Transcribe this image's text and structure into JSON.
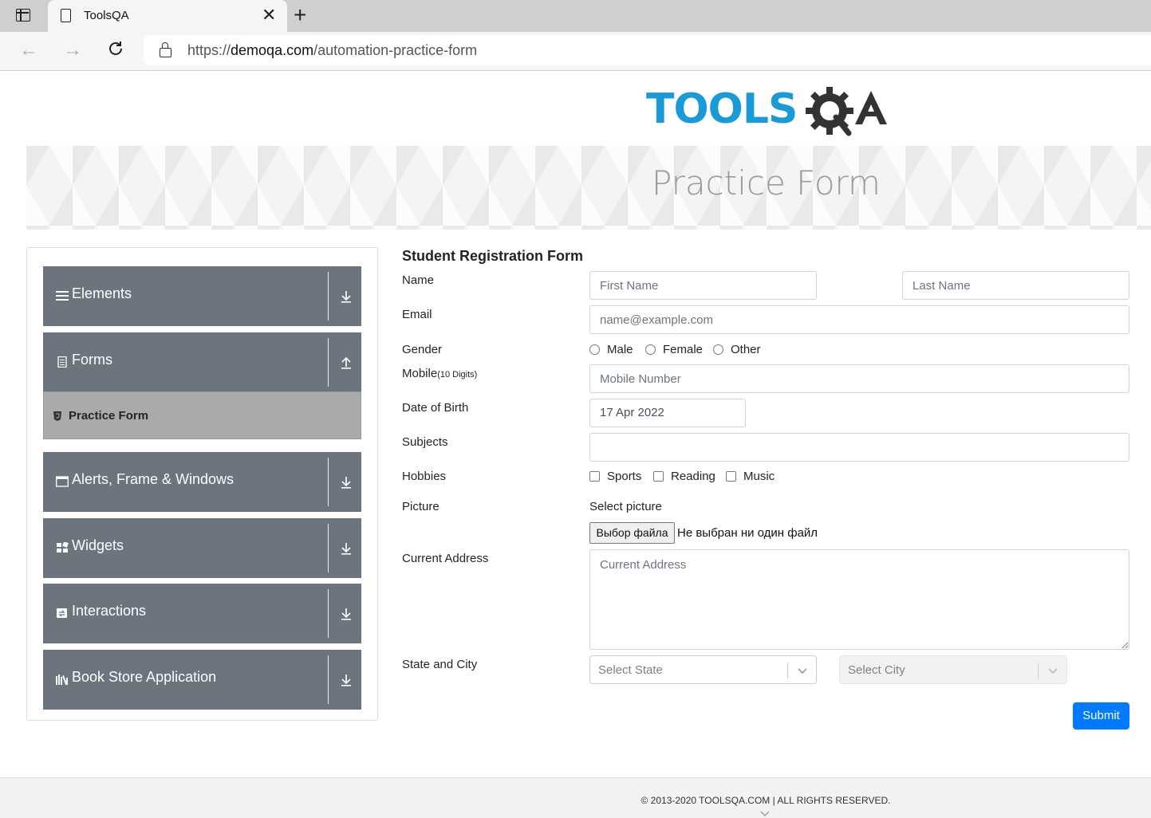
{
  "browser": {
    "tab_title": "ToolsQA",
    "url_scheme": "https://",
    "url_host": "demoqa.com",
    "url_path": "/automation-practice-form"
  },
  "banner": {
    "title": "Practice Form"
  },
  "logo": {
    "text": "TOOLSQA"
  },
  "sidebar": {
    "groups": [
      {
        "label": "Elements",
        "icon": "hamburger-icon",
        "expanded": false
      },
      {
        "label": "Forms",
        "icon": "document-icon",
        "expanded": true
      },
      {
        "label": "Alerts, Frame & Windows",
        "icon": "window-icon",
        "expanded": false
      },
      {
        "label": "Widgets",
        "icon": "widgets-icon",
        "expanded": false
      },
      {
        "label": "Interactions",
        "icon": "interactions-icon",
        "expanded": false
      },
      {
        "label": "Book Store Application",
        "icon": "books-icon",
        "expanded": false
      }
    ],
    "active_item": "Practice Form"
  },
  "form": {
    "title": "Student Registration Form",
    "labels": {
      "name": "Name",
      "email": "Email",
      "gender": "Gender",
      "mobile": "Mobile",
      "mobile_hint": "(10 Digits)",
      "dob": "Date of Birth",
      "subjects": "Subjects",
      "hobbies": "Hobbies",
      "picture": "Picture",
      "current_address": "Current Address",
      "state_city": "State and City"
    },
    "placeholders": {
      "first_name": "First Name",
      "last_name": "Last Name",
      "email": "name@example.com",
      "mobile": "Mobile Number",
      "current_address": "Current Address"
    },
    "dob_value": "17 Apr 2022",
    "genders": [
      "Male",
      "Female",
      "Other"
    ],
    "hobbies": [
      "Sports",
      "Reading",
      "Music"
    ],
    "picture_label": "Select picture",
    "file_button": "Выбор файла",
    "file_status": "Не выбран ни один файл",
    "state_placeholder": "Select State",
    "city_placeholder": "Select City",
    "submit": "Submit"
  },
  "colors": {
    "sidebar_group": "#6c757d",
    "active_item": "#aaaaaa",
    "primary": "#007bff",
    "logo_blue": "#1a9ad6",
    "logo_dark": "#333333"
  },
  "footer": {
    "text": "© 2013-2020 TOOLSQA.COM | ALL RIGHTS RESERVED."
  }
}
